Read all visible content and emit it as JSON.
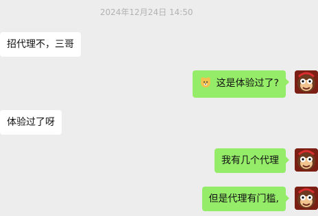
{
  "chat": {
    "timestamp": "2024年12月24日 14:50",
    "messages": [
      {
        "side": "left",
        "text": "招代理不，三哥"
      },
      {
        "side": "right",
        "emoji": "dog-emoji",
        "text": "这是体验过了?"
      },
      {
        "side": "left",
        "text": "体验过了呀"
      },
      {
        "side": "right",
        "text": "我有几个代理"
      },
      {
        "side": "right",
        "text": "但是代理有门槛,"
      }
    ]
  },
  "colors": {
    "background": "#ededed",
    "incoming_bubble": "#ffffff",
    "outgoing_bubble": "#95ec69",
    "timestamp_text": "#b2b2b2"
  },
  "icons": {
    "avatar": "monkey-avatar-icon"
  }
}
